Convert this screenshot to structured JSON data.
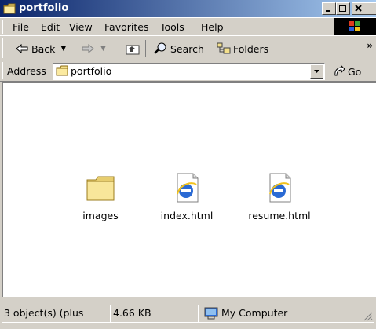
{
  "window": {
    "title": "portfolio",
    "buttons": {
      "minimize": "minimize",
      "maximize": "maximize",
      "close": "close"
    }
  },
  "menubar": {
    "items": [
      {
        "label": "File",
        "access": "F"
      },
      {
        "label": "Edit",
        "access": "E"
      },
      {
        "label": "View",
        "access": "V"
      },
      {
        "label": "Favorites",
        "access": "a"
      },
      {
        "label": "Tools",
        "access": "T"
      },
      {
        "label": "Help",
        "access": "H"
      }
    ]
  },
  "toolbar": {
    "back_label": "Back",
    "search_label": "Search",
    "folders_label": "Folders",
    "overflow": "»"
  },
  "address": {
    "label": "Address",
    "value": "portfolio",
    "go_label": "Go"
  },
  "files": [
    {
      "name": "images",
      "icon": "folder-icon"
    },
    {
      "name": "index.html",
      "icon": "ie-document-icon"
    },
    {
      "name": "resume.html",
      "icon": "ie-document-icon"
    }
  ],
  "statusbar": {
    "objects": "3 object(s) (plus",
    "size": "4.66 KB",
    "zone": "My Computer"
  },
  "colors": {
    "title_start": "#0a246a",
    "title_end": "#a6caf0",
    "face": "#d4d0c8",
    "folder": "#f4e08c"
  }
}
